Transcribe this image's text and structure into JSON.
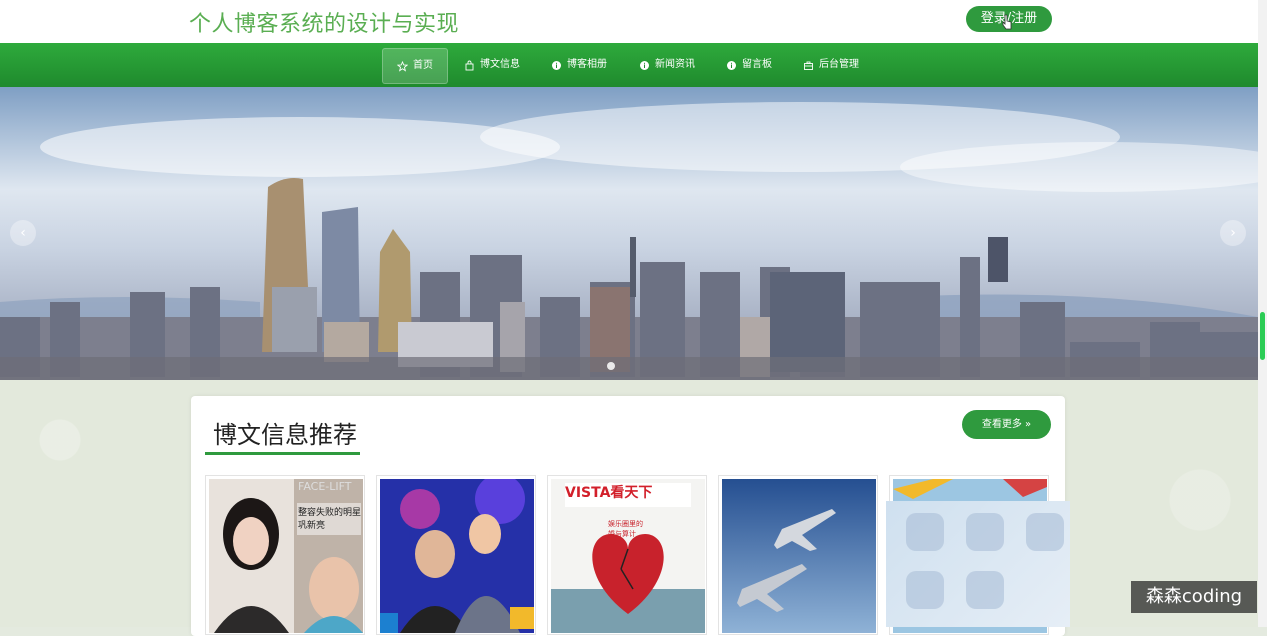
{
  "header": {
    "site_title": "个人博客系统的设计与实现",
    "login_label": "登录/注册"
  },
  "nav": {
    "items": [
      {
        "label": "首页",
        "icon": "star-icon",
        "active": true
      },
      {
        "label": "博文信息",
        "icon": "bag-icon"
      },
      {
        "label": "博客相册",
        "icon": "info-icon"
      },
      {
        "label": "新闻资讯",
        "icon": "info-icon"
      },
      {
        "label": "留言板",
        "icon": "info-icon"
      },
      {
        "label": "后台管理",
        "icon": "briefcase-icon"
      }
    ]
  },
  "banner": {
    "prev_label": "‹",
    "next_label": "›"
  },
  "section": {
    "title": "博文信息推荐",
    "more_label": "查看更多 »"
  },
  "cards": [
    {
      "caption_line1": "FACE-LIFT",
      "caption_line2": "整容失败的明星",
      "caption_line3": "巩新亮"
    },
    {
      "caption_line1": ""
    },
    {
      "caption_line1": "VISTA看天下",
      "caption_line2": "娱乐圈里的",
      "caption_line3": "婚与算计"
    },
    {
      "caption_line1": ""
    },
    {
      "caption_line1": ""
    }
  ],
  "watermark": "森森coding",
  "colors": {
    "primary": "#2f9a3e",
    "title_green": "#5aae52"
  }
}
